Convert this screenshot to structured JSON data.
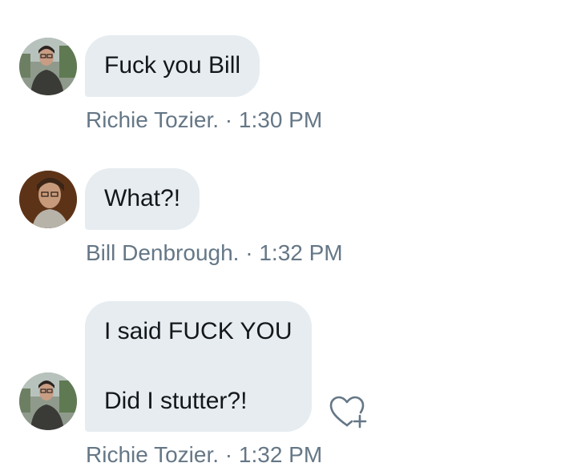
{
  "messages": [
    {
      "text": "Fuck you Bill",
      "author": "Richie Tozier.",
      "separator": "·",
      "time": "1:30 PM"
    },
    {
      "text": "What?!",
      "author": "Bill Denbrough.",
      "separator": "·",
      "time": "1:32 PM"
    },
    {
      "lines": [
        "I said FUCK YOU",
        "Did I stutter?!"
      ],
      "author": "Richie Tozier.",
      "separator": "·",
      "time": "1:32 PM"
    }
  ],
  "icons": {
    "like": "heart-plus-icon"
  },
  "colors": {
    "bubble": "#e6ecf0",
    "text": "#14171a",
    "meta": "#657786",
    "icon": "#657786"
  }
}
